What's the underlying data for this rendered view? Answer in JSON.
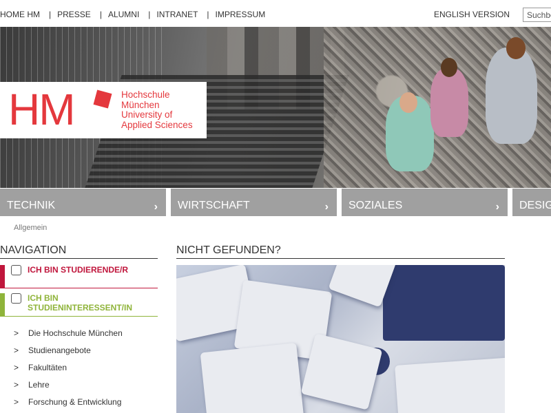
{
  "topnav": {
    "items": [
      "HOME HM",
      "PRESSE",
      "ALUMNI",
      "INTRANET",
      "IMPRESSUM"
    ],
    "separator": "|",
    "english": "ENGLISH VERSION",
    "search_placeholder": "Suchbegriff"
  },
  "logo": {
    "mark": "HM",
    "lines": [
      "Hochschule",
      "München",
      "University of",
      "Applied Sciences"
    ],
    "color": "#e4383d"
  },
  "faculties": [
    {
      "label": "TECHNIK",
      "arrow": "›"
    },
    {
      "label": "WIRTSCHAFT",
      "arrow": "›"
    },
    {
      "label": "SOZIALES",
      "arrow": "›"
    },
    {
      "label": "DESIGN"
    }
  ],
  "breadcrumb": "Allgemein",
  "sidebar": {
    "title": "NAVIGATION",
    "roles": [
      {
        "label": "ICH BIN STUDIERENDE/R",
        "color": "#c0163c"
      },
      {
        "label": "ICH BIN STUDIENINTERESSENT/IN",
        "color": "#8fb43a"
      }
    ],
    "bullet": ">",
    "items": [
      "Die Hochschule München",
      "Studienangebote",
      "Fakultäten",
      "Lehre",
      "Forschung & Entwicklung"
    ]
  },
  "main": {
    "title": "NICHT GEFUNDEN?"
  }
}
